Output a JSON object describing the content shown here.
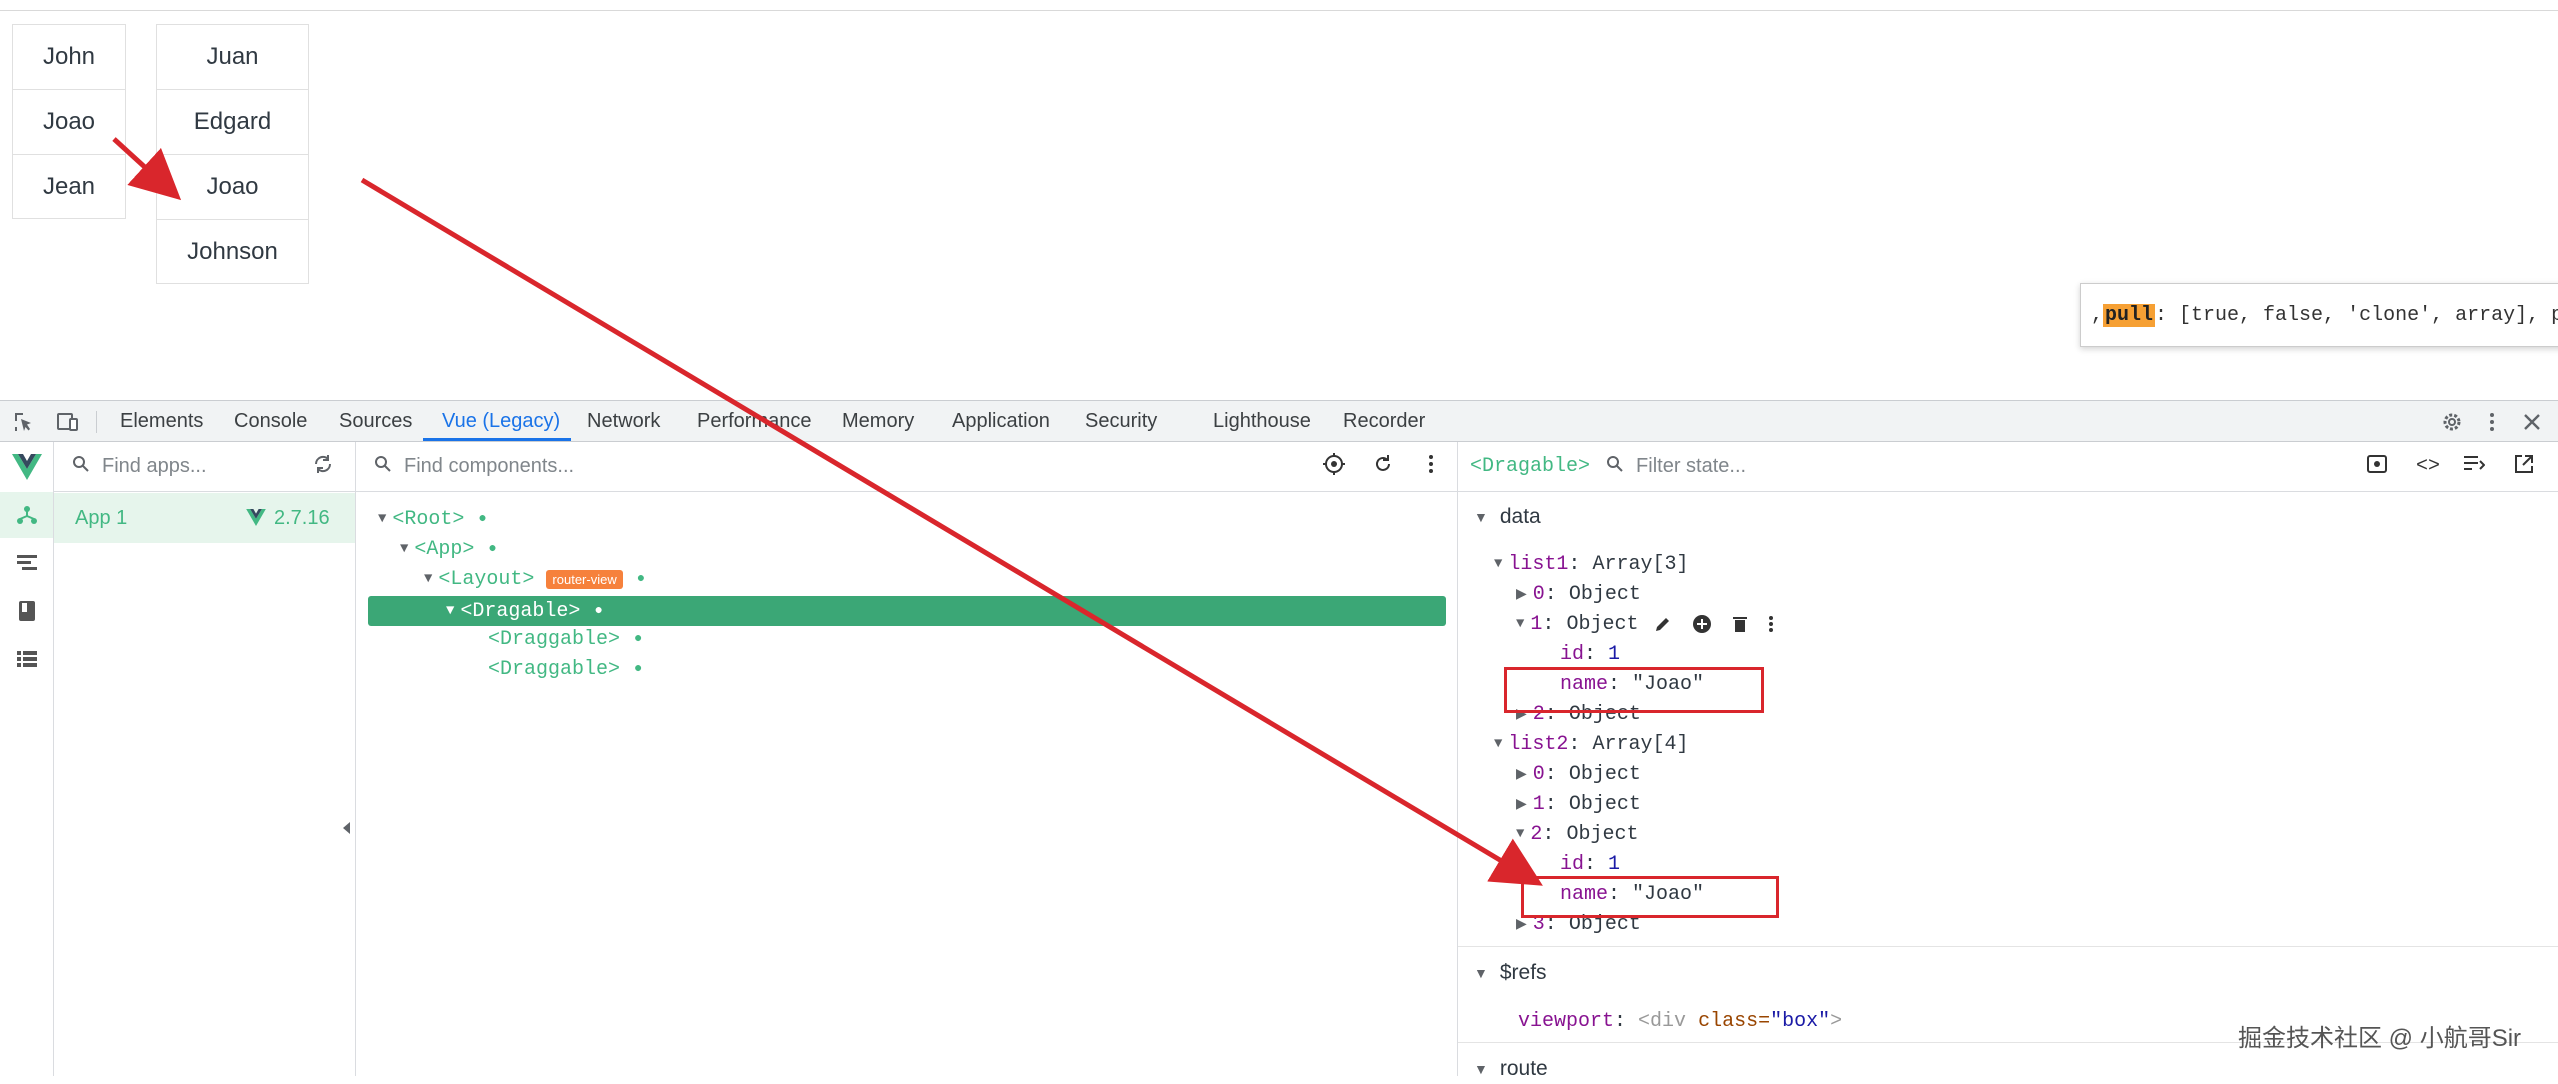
{
  "page": {
    "list1": [
      "John",
      "Joao",
      "Jean"
    ],
    "list2": [
      "Juan",
      "Edgard",
      "Joao",
      "Johnson"
    ],
    "tooltip": {
      "prefix": ", ",
      "highlight": "pull",
      "rest": ": [true, false, 'clone', array], put:"
    }
  },
  "devtools": {
    "tabs": [
      "Elements",
      "Console",
      "Sources",
      "Vue (Legacy)",
      "Network",
      "Performance",
      "Memory",
      "Application",
      "Security",
      "Lighthouse",
      "Recorder"
    ],
    "active_tab": "Vue (Legacy)",
    "apps": {
      "search_placeholder": "Find apps...",
      "app_name": "App 1",
      "version": "2.7.16"
    },
    "components": {
      "search_placeholder": "Find components...",
      "tree": [
        {
          "label": "<Root>"
        },
        {
          "label": "<App>"
        },
        {
          "label": "<Layout>",
          "badge": "router-view"
        },
        {
          "label": "<Dragable>",
          "selected": true
        },
        {
          "label": "<Draggable>"
        },
        {
          "label": "<Draggable>"
        }
      ]
    },
    "state": {
      "selected_component": "<Dragable>",
      "filter_placeholder": "Filter state...",
      "data_header": "data",
      "list1_key": "list1",
      "list1_type": "Array[3]",
      "list2_key": "list2",
      "list2_type": "Array[4]",
      "item0": "0",
      "item1": "1",
      "item2": "2",
      "item3": "3",
      "object_label": "Object",
      "id_key": "id",
      "id_value": "1",
      "name_key": "name",
      "name_value": "\"Joao\"",
      "refs_header": "$refs",
      "viewport_key": "viewport",
      "viewport_value_tag": "<div",
      "viewport_value_attr": "class=",
      "viewport_value_str": "\"box\"",
      "viewport_value_end": ">",
      "route_header": "route"
    }
  },
  "watermark": "掘金技术社区 @ 小航哥Sir",
  "colors": {
    "vue_green": "#42b883",
    "annotation_red": "#d9262c",
    "active_tab": "#1a73e8"
  }
}
